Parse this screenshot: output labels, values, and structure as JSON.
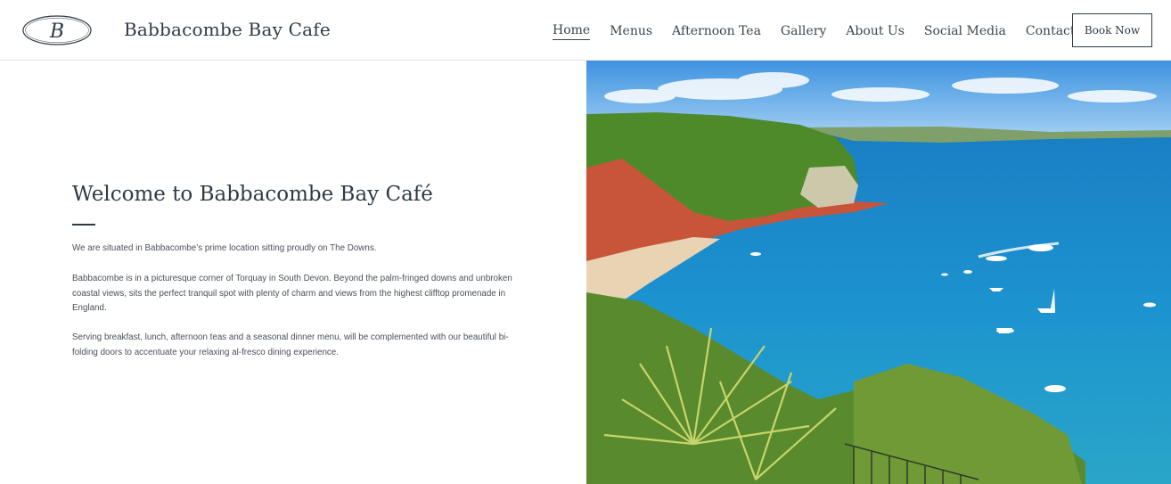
{
  "header": {
    "logo_letter": "B",
    "site_title": "Babbacombe Bay Cafe",
    "nav": [
      {
        "label": "Home",
        "active": true
      },
      {
        "label": "Menus",
        "active": false
      },
      {
        "label": "Afternoon Tea",
        "active": false
      },
      {
        "label": "Gallery",
        "active": false
      },
      {
        "label": "About Us",
        "active": false
      },
      {
        "label": "Social Media",
        "active": false
      },
      {
        "label": "Contact",
        "active": false
      }
    ],
    "cta_label": "Book Now"
  },
  "main": {
    "title": "Welcome to Babbacombe Bay Café",
    "paragraphs": [
      "We are situated in Babbacombe’s prime location sitting proudly on The Downs.",
      "Babbacombe is in a picturesque corner of Torquay in South Devon. Beyond the  palm-fringed downs and unbroken coastal views, sits the perfect tranquil spot with plenty of charm and views from the highest clifftop promenade in England.",
      "Serving breakfast, lunch, afternoon teas and a  seasonal dinner menu, will be complemented with our beautiful bi-folding doors to accentuate your relaxing al-fresco dining experience."
    ]
  },
  "colors": {
    "text_dark": "#2f3a44",
    "sea": "#1e88c6",
    "sky": "#5fa8e8",
    "cliff": "#c8553a",
    "foliage": "#4f8a2a"
  }
}
